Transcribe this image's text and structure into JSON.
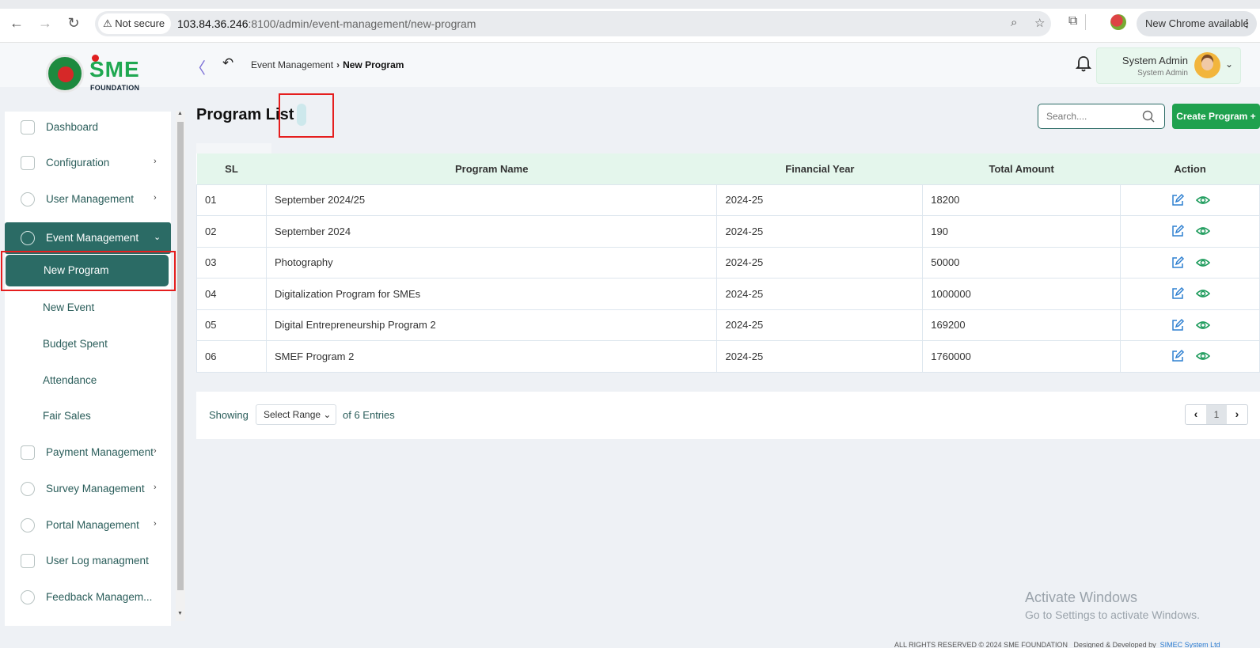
{
  "browser": {
    "security_label": "Not secure",
    "url_host": "103.84.36.246",
    "url_path": ":8100/admin/event-management/new-program",
    "update_label": "New Chrome available"
  },
  "header": {
    "logo": {
      "mark": "SME",
      "subtitle": "FOUNDATION"
    },
    "breadcrumb": {
      "parent": "Event Management",
      "current": "New Program"
    },
    "user": {
      "name": "System Admin",
      "role": "System Admin"
    }
  },
  "sidebar": {
    "items": [
      {
        "label": "Dashboard",
        "arrow": ""
      },
      {
        "label": "Configuration",
        "arrow": "›"
      },
      {
        "label": "User Management",
        "arrow": "›"
      },
      {
        "label": "Event Management",
        "arrow": "⌄"
      },
      {
        "label": "Payment Management",
        "arrow": "›"
      },
      {
        "label": "Survey Management",
        "arrow": "›"
      },
      {
        "label": "Portal Management",
        "arrow": "›"
      },
      {
        "label": "User Log managment",
        "arrow": ""
      },
      {
        "label": "Feedback Managem...",
        "arrow": ""
      }
    ],
    "subitems": [
      {
        "label": "New Program"
      },
      {
        "label": "New Event"
      },
      {
        "label": "Budget Spent"
      },
      {
        "label": "Attendance"
      },
      {
        "label": "Fair Sales"
      }
    ]
  },
  "main": {
    "title": "Program List",
    "search_placeholder": "Search....",
    "create_label": "Create Program +",
    "table": {
      "headers": [
        "SL",
        "Program Name",
        "Financial Year",
        "Total Amount",
        "Action"
      ],
      "rows": [
        {
          "sl": "01",
          "name": "September 2024/25",
          "year": "2024-25",
          "amount": "18200"
        },
        {
          "sl": "02",
          "name": "September 2024",
          "year": "2024-25",
          "amount": "190"
        },
        {
          "sl": "03",
          "name": "Photography",
          "year": "2024-25",
          "amount": "50000"
        },
        {
          "sl": "04",
          "name": "Digitalization Program for SMEs",
          "year": "2024-25",
          "amount": "1000000"
        },
        {
          "sl": "05",
          "name": "Digital Entrepreneurship Program 2",
          "year": "2024-25",
          "amount": "169200"
        },
        {
          "sl": "06",
          "name": "SMEF Program 2",
          "year": "2024-25",
          "amount": "1760000"
        }
      ]
    },
    "pagination": {
      "showing": "Showing",
      "range_label": "Select Range",
      "entries": "of 6 Entries",
      "page": "1"
    }
  },
  "os": {
    "watermark_title": "Activate Windows",
    "watermark_sub": "Go to Settings to activate Windows."
  },
  "footer": {
    "copyright": "ALL RIGHTS RESERVED © 2024 SME FOUNDATION",
    "designed_by": "Designed & Developed by",
    "developer": "SIMEC System Ltd"
  },
  "colors": {
    "brand_green": "#1fa14e",
    "sidebar_active": "#2b6b65",
    "header_row": "#e4f6ec",
    "annotation_red": "#e51e1e"
  }
}
